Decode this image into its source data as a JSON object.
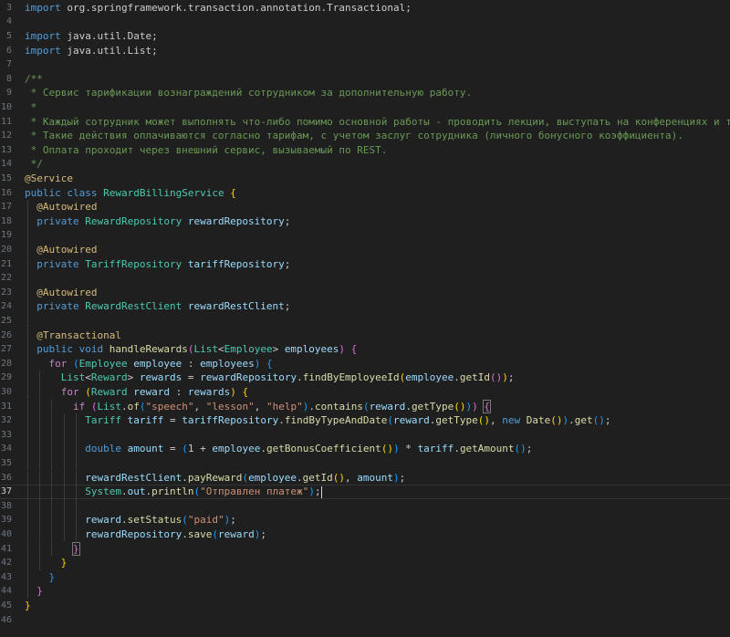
{
  "editor": {
    "language": "java",
    "current_line": "37",
    "lines": [
      {
        "n": "3",
        "tokens": [
          {
            "t": "import",
            "c": "kw"
          },
          {
            "t": " org.springframework.transaction.annotation.Transactional;"
          }
        ]
      },
      {
        "n": "4",
        "tokens": []
      },
      {
        "n": "5",
        "tokens": [
          {
            "t": "import",
            "c": "kw"
          },
          {
            "t": " java.util.Date;"
          }
        ]
      },
      {
        "n": "6",
        "tokens": [
          {
            "t": "import",
            "c": "kw"
          },
          {
            "t": " java.util.List;"
          }
        ]
      },
      {
        "n": "7",
        "tokens": []
      },
      {
        "n": "8",
        "tokens": [
          {
            "t": "/**",
            "c": "cm"
          }
        ]
      },
      {
        "n": "9",
        "tokens": [
          {
            "t": " * Сервис тарификации вознаграждений сотрудником за дополнительную работу.",
            "c": "cm"
          }
        ]
      },
      {
        "n": "10",
        "tokens": [
          {
            "t": " *",
            "c": "cm"
          }
        ]
      },
      {
        "n": "11",
        "tokens": [
          {
            "t": " * Каждый сотрудник может выполнять что-либо помимо основной работы - проводить лекции, выступать на конференциях и т.д.",
            "c": "cm"
          }
        ]
      },
      {
        "n": "12",
        "tokens": [
          {
            "t": " * Такие действия оплачиваются согласно тарифам, с учетом заслуг сотрудника (личного бонусного коэффициента).",
            "c": "cm"
          }
        ]
      },
      {
        "n": "13",
        "tokens": [
          {
            "t": " * Оплата проходит через внешний сервис, вызываемый по REST.",
            "c": "cm"
          }
        ]
      },
      {
        "n": "14",
        "tokens": [
          {
            "t": " */",
            "c": "cm"
          }
        ]
      },
      {
        "n": "15",
        "tokens": [
          {
            "t": "@Service",
            "c": "ann"
          }
        ]
      },
      {
        "n": "16",
        "tokens": [
          {
            "t": "public class",
            "c": "kw"
          },
          {
            "t": " "
          },
          {
            "t": "RewardBillingService",
            "c": "ty"
          },
          {
            "t": " "
          },
          {
            "t": "{",
            "c": "p1"
          }
        ]
      },
      {
        "n": "17",
        "tokens": [
          {
            "t": "  "
          },
          {
            "t": "@Autowired",
            "c": "ann"
          }
        ]
      },
      {
        "n": "18",
        "tokens": [
          {
            "t": "  "
          },
          {
            "t": "private",
            "c": "kw"
          },
          {
            "t": " "
          },
          {
            "t": "RewardRepository",
            "c": "ty"
          },
          {
            "t": " "
          },
          {
            "t": "rewardRepository",
            "c": "var"
          },
          {
            "t": ";"
          }
        ]
      },
      {
        "n": "19",
        "tokens": []
      },
      {
        "n": "20",
        "tokens": [
          {
            "t": "  "
          },
          {
            "t": "@Autowired",
            "c": "ann"
          }
        ]
      },
      {
        "n": "21",
        "tokens": [
          {
            "t": "  "
          },
          {
            "t": "private",
            "c": "kw"
          },
          {
            "t": " "
          },
          {
            "t": "TariffRepository",
            "c": "ty"
          },
          {
            "t": " "
          },
          {
            "t": "tariffRepository",
            "c": "var"
          },
          {
            "t": ";"
          }
        ]
      },
      {
        "n": "22",
        "tokens": []
      },
      {
        "n": "23",
        "tokens": [
          {
            "t": "  "
          },
          {
            "t": "@Autowired",
            "c": "ann"
          }
        ]
      },
      {
        "n": "24",
        "tokens": [
          {
            "t": "  "
          },
          {
            "t": "private",
            "c": "kw"
          },
          {
            "t": " "
          },
          {
            "t": "RewardRestClient",
            "c": "ty"
          },
          {
            "t": " "
          },
          {
            "t": "rewardRestClient",
            "c": "var"
          },
          {
            "t": ";"
          }
        ]
      },
      {
        "n": "25",
        "tokens": []
      },
      {
        "n": "26",
        "tokens": [
          {
            "t": "  "
          },
          {
            "t": "@Transactional",
            "c": "ann"
          }
        ]
      },
      {
        "n": "27",
        "tokens": [
          {
            "t": "  "
          },
          {
            "t": "public void",
            "c": "kw"
          },
          {
            "t": " "
          },
          {
            "t": "handleRewards",
            "c": "fn"
          },
          {
            "t": "(",
            "c": "p2"
          },
          {
            "t": "List",
            "c": "ty"
          },
          {
            "t": "<"
          },
          {
            "t": "Employee",
            "c": "ty"
          },
          {
            "t": "> "
          },
          {
            "t": "employees",
            "c": "var"
          },
          {
            "t": ")",
            "c": "p2"
          },
          {
            "t": " "
          },
          {
            "t": "{",
            "c": "p2"
          }
        ]
      },
      {
        "n": "28",
        "tokens": [
          {
            "t": "    "
          },
          {
            "t": "for",
            "c": "kc"
          },
          {
            "t": " "
          },
          {
            "t": "(",
            "c": "p3"
          },
          {
            "t": "Employee",
            "c": "ty"
          },
          {
            "t": " "
          },
          {
            "t": "employee",
            "c": "var"
          },
          {
            "t": " : "
          },
          {
            "t": "employees",
            "c": "var"
          },
          {
            "t": ")",
            "c": "p3"
          },
          {
            "t": " "
          },
          {
            "t": "{",
            "c": "p3"
          }
        ]
      },
      {
        "n": "29",
        "tokens": [
          {
            "t": "      "
          },
          {
            "t": "List",
            "c": "ty"
          },
          {
            "t": "<"
          },
          {
            "t": "Reward",
            "c": "ty"
          },
          {
            "t": "> "
          },
          {
            "t": "rewards",
            "c": "var"
          },
          {
            "t": " = "
          },
          {
            "t": "rewardRepository",
            "c": "var"
          },
          {
            "t": "."
          },
          {
            "t": "findByEmployeeId",
            "c": "fn"
          },
          {
            "t": "(",
            "c": "p1"
          },
          {
            "t": "employee",
            "c": "var"
          },
          {
            "t": "."
          },
          {
            "t": "getId",
            "c": "fn"
          },
          {
            "t": "()",
            "c": "p2"
          },
          {
            "t": ")",
            "c": "p1"
          },
          {
            "t": ";"
          }
        ]
      },
      {
        "n": "30",
        "tokens": [
          {
            "t": "      "
          },
          {
            "t": "for",
            "c": "kc"
          },
          {
            "t": " "
          },
          {
            "t": "(",
            "c": "p1"
          },
          {
            "t": "Reward",
            "c": "ty"
          },
          {
            "t": " "
          },
          {
            "t": "reward",
            "c": "var"
          },
          {
            "t": " : "
          },
          {
            "t": "rewards",
            "c": "var"
          },
          {
            "t": ")",
            "c": "p1"
          },
          {
            "t": " "
          },
          {
            "t": "{",
            "c": "p1"
          }
        ]
      },
      {
        "n": "31",
        "tokens": [
          {
            "t": "        "
          },
          {
            "t": "if",
            "c": "kc"
          },
          {
            "t": " "
          },
          {
            "t": "(",
            "c": "p2"
          },
          {
            "t": "List",
            "c": "ty"
          },
          {
            "t": "."
          },
          {
            "t": "of",
            "c": "fn"
          },
          {
            "t": "(",
            "c": "p3"
          },
          {
            "t": "\"speech\"",
            "c": "str"
          },
          {
            "t": ", "
          },
          {
            "t": "\"lesson\"",
            "c": "str"
          },
          {
            "t": ", "
          },
          {
            "t": "\"help\"",
            "c": "str"
          },
          {
            "t": ")",
            "c": "p3"
          },
          {
            "t": "."
          },
          {
            "t": "contains",
            "c": "fn"
          },
          {
            "t": "(",
            "c": "p3"
          },
          {
            "t": "reward",
            "c": "var"
          },
          {
            "t": "."
          },
          {
            "t": "getType",
            "c": "fn"
          },
          {
            "t": "()",
            "c": "p1"
          },
          {
            "t": ")",
            "c": "p3"
          },
          {
            "t": ")",
            "c": "p2"
          },
          {
            "t": " "
          },
          {
            "t": "{",
            "c": "p2 bm"
          }
        ]
      },
      {
        "n": "32",
        "tokens": [
          {
            "t": "          "
          },
          {
            "t": "Tariff",
            "c": "ty"
          },
          {
            "t": " "
          },
          {
            "t": "tariff",
            "c": "var"
          },
          {
            "t": " = "
          },
          {
            "t": "tariffRepository",
            "c": "var"
          },
          {
            "t": "."
          },
          {
            "t": "findByTypeAndDate",
            "c": "fn"
          },
          {
            "t": "(",
            "c": "p3"
          },
          {
            "t": "reward",
            "c": "var"
          },
          {
            "t": "."
          },
          {
            "t": "getType",
            "c": "fn"
          },
          {
            "t": "()",
            "c": "p1"
          },
          {
            "t": ", "
          },
          {
            "t": "new",
            "c": "kw"
          },
          {
            "t": " "
          },
          {
            "t": "Date",
            "c": "fn"
          },
          {
            "t": "()",
            "c": "p1"
          },
          {
            "t": ")",
            "c": "p3"
          },
          {
            "t": "."
          },
          {
            "t": "get",
            "c": "fn"
          },
          {
            "t": "()",
            "c": "p3"
          },
          {
            "t": ";"
          }
        ]
      },
      {
        "n": "33",
        "tokens": []
      },
      {
        "n": "34",
        "tokens": [
          {
            "t": "          "
          },
          {
            "t": "double",
            "c": "kw"
          },
          {
            "t": " "
          },
          {
            "t": "amount",
            "c": "var"
          },
          {
            "t": " = "
          },
          {
            "t": "(",
            "c": "p3"
          },
          {
            "t": "1 + "
          },
          {
            "t": "employee",
            "c": "var"
          },
          {
            "t": "."
          },
          {
            "t": "getBonusCoefficient",
            "c": "fn"
          },
          {
            "t": "()",
            "c": "p1"
          },
          {
            "t": ")",
            "c": "p3"
          },
          {
            "t": " * "
          },
          {
            "t": "tariff",
            "c": "var"
          },
          {
            "t": "."
          },
          {
            "t": "getAmount",
            "c": "fn"
          },
          {
            "t": "()",
            "c": "p3"
          },
          {
            "t": ";"
          }
        ]
      },
      {
        "n": "35",
        "tokens": []
      },
      {
        "n": "36",
        "tokens": [
          {
            "t": "          "
          },
          {
            "t": "rewardRestClient",
            "c": "var"
          },
          {
            "t": "."
          },
          {
            "t": "payReward",
            "c": "fn"
          },
          {
            "t": "(",
            "c": "p3"
          },
          {
            "t": "employee",
            "c": "var"
          },
          {
            "t": "."
          },
          {
            "t": "getId",
            "c": "fn"
          },
          {
            "t": "()",
            "c": "p1"
          },
          {
            "t": ", "
          },
          {
            "t": "amount",
            "c": "var"
          },
          {
            "t": ")",
            "c": "p3"
          },
          {
            "t": ";"
          }
        ]
      },
      {
        "n": "37",
        "tokens": [
          {
            "t": "          "
          },
          {
            "t": "System",
            "c": "ty"
          },
          {
            "t": "."
          },
          {
            "t": "out",
            "c": "var"
          },
          {
            "t": "."
          },
          {
            "t": "println",
            "c": "fn"
          },
          {
            "t": "(",
            "c": "p3"
          },
          {
            "t": "\"Отправлен платеж\"",
            "c": "str"
          },
          {
            "t": ")",
            "c": "p3"
          },
          {
            "t": ";"
          }
        ]
      },
      {
        "n": "38",
        "tokens": []
      },
      {
        "n": "39",
        "tokens": [
          {
            "t": "          "
          },
          {
            "t": "reward",
            "c": "var"
          },
          {
            "t": "."
          },
          {
            "t": "setStatus",
            "c": "fn"
          },
          {
            "t": "(",
            "c": "p3"
          },
          {
            "t": "\"paid\"",
            "c": "str"
          },
          {
            "t": ")",
            "c": "p3"
          },
          {
            "t": ";"
          }
        ]
      },
      {
        "n": "40",
        "tokens": [
          {
            "t": "          "
          },
          {
            "t": "rewardRepository",
            "c": "var"
          },
          {
            "t": "."
          },
          {
            "t": "save",
            "c": "fn"
          },
          {
            "t": "(",
            "c": "p3"
          },
          {
            "t": "reward",
            "c": "var"
          },
          {
            "t": ")",
            "c": "p3"
          },
          {
            "t": ";"
          }
        ]
      },
      {
        "n": "41",
        "tokens": [
          {
            "t": "        "
          },
          {
            "t": "}",
            "c": "p2 bm"
          }
        ]
      },
      {
        "n": "42",
        "tokens": [
          {
            "t": "      "
          },
          {
            "t": "}",
            "c": "p1"
          }
        ]
      },
      {
        "n": "43",
        "tokens": [
          {
            "t": "    "
          },
          {
            "t": "}",
            "c": "p3"
          }
        ]
      },
      {
        "n": "44",
        "tokens": [
          {
            "t": "  "
          },
          {
            "t": "}",
            "c": "p2"
          }
        ]
      },
      {
        "n": "45",
        "tokens": [
          {
            "t": "}",
            "c": "p1"
          }
        ]
      },
      {
        "n": "46",
        "tokens": []
      }
    ]
  }
}
